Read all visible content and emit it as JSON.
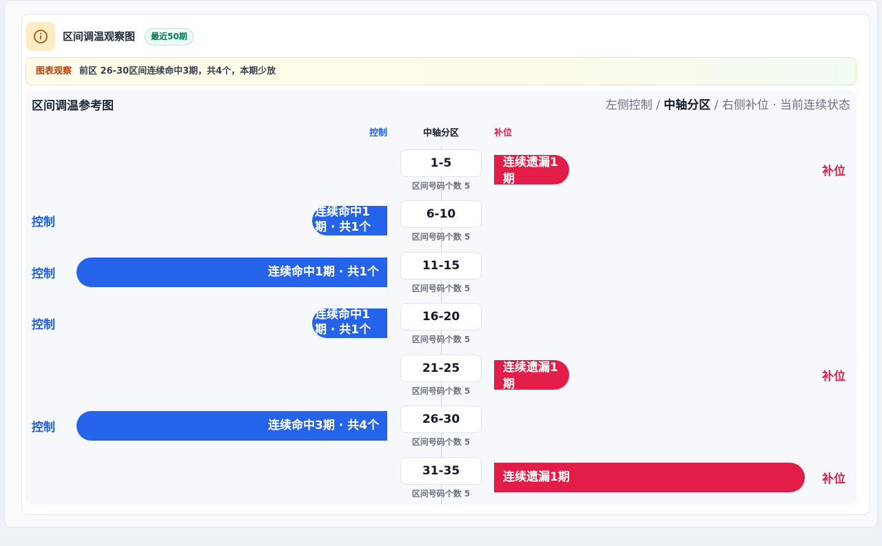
{
  "header": {
    "title": "区间调温观察图",
    "badge": "最近50期",
    "icon": "info-icon"
  },
  "observation": {
    "tag": "图表观察",
    "text": "前区 26-30区间连续命中3期，共4个，本期少放"
  },
  "panel": {
    "title": "区间调温参考图",
    "legend_left": "左侧控制 / ",
    "legend_mid": "中轴分区",
    "legend_right": " / 右侧补位 · 当前连续状态"
  },
  "columns": {
    "left": "控制",
    "center": "中轴分区",
    "right": "补位"
  },
  "colors": {
    "control": "#2563eb",
    "fill": "#e11d48"
  },
  "rows": [
    {
      "zone": "1-5",
      "sub": "区间号码个数 5",
      "side_label": "补位",
      "bar_text": "连续遗漏1期"
    },
    {
      "zone": "6-10",
      "sub": "区间号码个数 5",
      "side_label": "控制",
      "bar_text": "连续命中1期 · 共1个"
    },
    {
      "zone": "11-15",
      "sub": "区间号码个数 5",
      "side_label": "控制",
      "bar_text": "连续命中1期 · 共1个"
    },
    {
      "zone": "16-20",
      "sub": "区间号码个数 5",
      "side_label": "控制",
      "bar_text": "连续命中1期 · 共1个"
    },
    {
      "zone": "21-25",
      "sub": "区间号码个数 5",
      "side_label": "补位",
      "bar_text": "连续遗漏1期"
    },
    {
      "zone": "26-30",
      "sub": "区间号码个数 5",
      "side_label": "控制",
      "bar_text": "连续命中3期 · 共4个"
    },
    {
      "zone": "31-35",
      "sub": "区间号码个数 5",
      "side_label": "补位",
      "bar_text": "连续遗漏1期"
    }
  ]
}
